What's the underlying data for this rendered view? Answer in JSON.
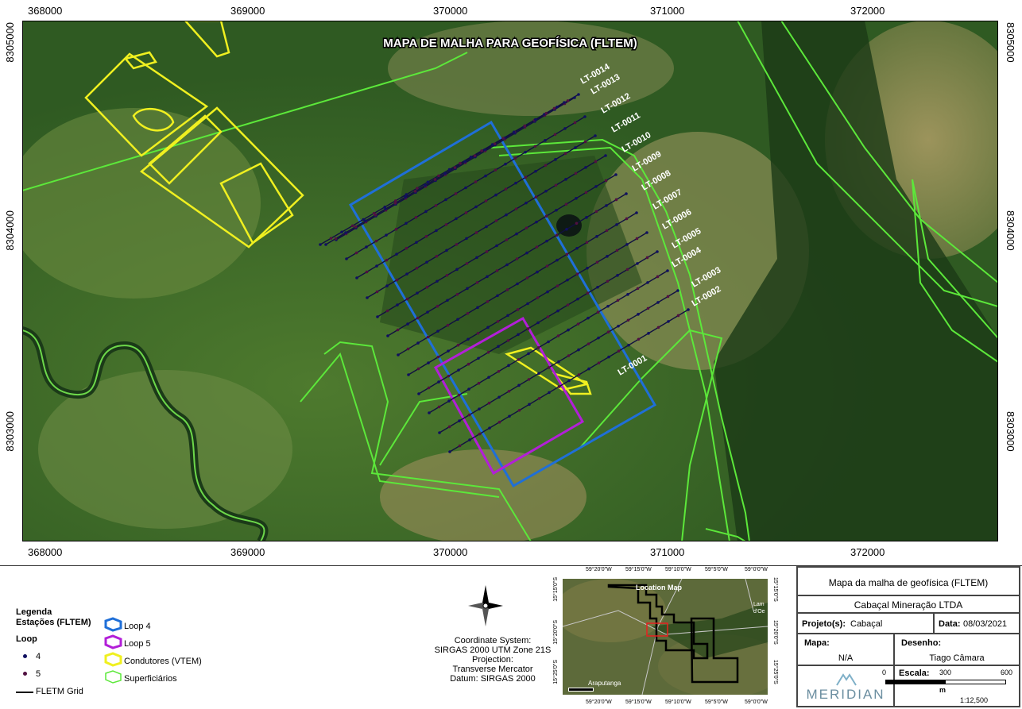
{
  "map": {
    "title": "MAPA DE MALHA PARA GEOFÍSICA (FLTEM)",
    "x_ticks": [
      "368000",
      "369000",
      "370000",
      "371000",
      "372000"
    ],
    "y_ticks": [
      "8305000",
      "8304000",
      "8303000"
    ],
    "line_labels": [
      "LT-0014",
      "LT-0013",
      "LT-0012",
      "LT-0011",
      "LT-0010",
      "LT-0009",
      "LT-0008",
      "LT-0007",
      "LT-0006",
      "LT-0005",
      "LT-0004",
      "LT-0003",
      "LT-0002",
      "LT-0001"
    ],
    "colors": {
      "loop4": "#1f6fd8",
      "loop5": "#b21fd8",
      "condutores": "#f0f020",
      "superficiarios": "#5ce83a",
      "stations4": "#101060",
      "stations5": "#501040"
    }
  },
  "legend": {
    "heading": "Legenda",
    "stations": "Estações (FLTEM)",
    "loop": "Loop",
    "loop_4": "4",
    "loop_5": "5",
    "grid": "FLETM Grid",
    "items": [
      "Loop 4",
      "Loop 5",
      "Condutores (VTEM)",
      "Superficiários"
    ]
  },
  "crs": {
    "l1": "Coordinate System:",
    "l2": "SIRGAS 2000 UTM Zone 21S",
    "l3": "Projection:",
    "l4": "Transverse Mercator",
    "l5": "Datum: SIRGAS 2000"
  },
  "inset": {
    "title": "Location Map",
    "top_ticks": [
      "59°20'0\"W",
      "59°15'0\"W",
      "59°10'0\"W",
      "59°5'0\"W",
      "59°0'0\"W"
    ],
    "bottom_ticks": [
      "59°20'0\"W",
      "59°15'0\"W",
      "59°10'0\"W",
      "59°5'0\"W",
      "59°0'0\"W"
    ],
    "left_ticks": [
      "15°15'0\"S",
      "15°20'0\"S",
      "15°25'0\"S"
    ],
    "right_ticks": [
      "15°15'0\"S",
      "15°20'0\"S",
      "15°25'0\"S"
    ],
    "town1": "Araputanga",
    "town2": "Lam d'Oe"
  },
  "titleblock": {
    "title": "Mapa da malha de geofísica (FLTEM)",
    "company": "Cabaçal Mineração LTDA",
    "project_label": "Projeto(s):",
    "project_value": "Cabaçal",
    "date_label": "Data:",
    "date_value": "08/03/2021",
    "mapa_label": "Mapa:",
    "mapa_value": "N/A",
    "desenho_label": "Desenho:",
    "desenho_value": "Tiago Câmara",
    "logo": "MERIDIAN",
    "escala_label": "Escala:",
    "scale_0": "0",
    "scale_300": "300",
    "scale_600": "600",
    "scale_unit": "m",
    "scale_ratio": "1:12,500"
  }
}
